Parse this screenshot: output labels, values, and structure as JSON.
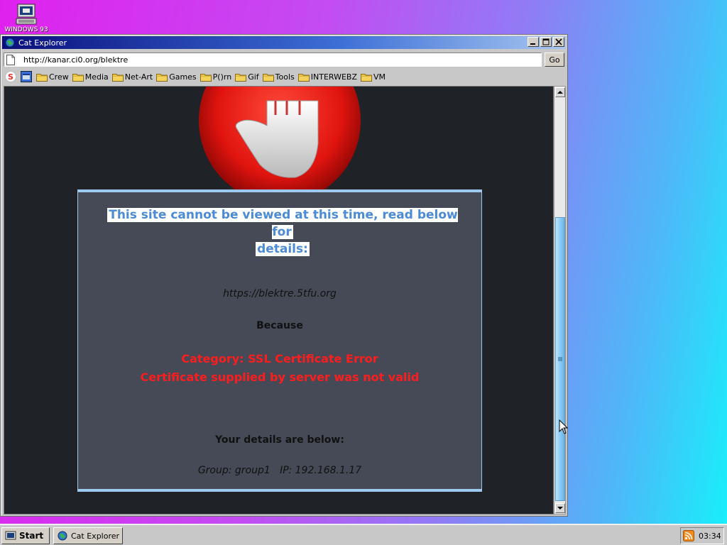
{
  "desktop": {
    "icon_label": "WINDOWS 93",
    "icon": "computer-icon"
  },
  "window": {
    "title": "Cat Explorer",
    "app_icon": "globe-icon",
    "controls": [
      "minimize",
      "maximize",
      "close"
    ]
  },
  "addressbar": {
    "url": "http://kanar.ci0.org/blektre",
    "go_label": "Go"
  },
  "linkbar": {
    "icons": [
      "s-logo-icon",
      "window-app-icon"
    ],
    "folders": [
      "Crew",
      "Media",
      "Net-Art",
      "Games",
      "P()rn",
      "Gif",
      "Tools",
      "INTERWEBZ",
      "VM"
    ]
  },
  "page": {
    "heading_line1": "This site cannot be viewed at this time, read below for",
    "heading_line2": "details:",
    "site_url": "https://blektre.5tfu.org",
    "because": "Because",
    "category": "Category: SSL Certificate Error",
    "cert_message": "Certificate supplied by server was not valid",
    "details_heading": "Your details are below:",
    "details_line": "Group: group1   IP: 192.168.1.17"
  },
  "taskbar": {
    "start_label": "Start",
    "task_label": "Cat Explorer",
    "clock": "03:34",
    "tray_icon": "rss-icon"
  },
  "colors": {
    "heading_blue": "#4a8ad6",
    "error_red": "#ff1c1c",
    "box_bg": "#454a56",
    "page_bg": "#1f2227"
  }
}
